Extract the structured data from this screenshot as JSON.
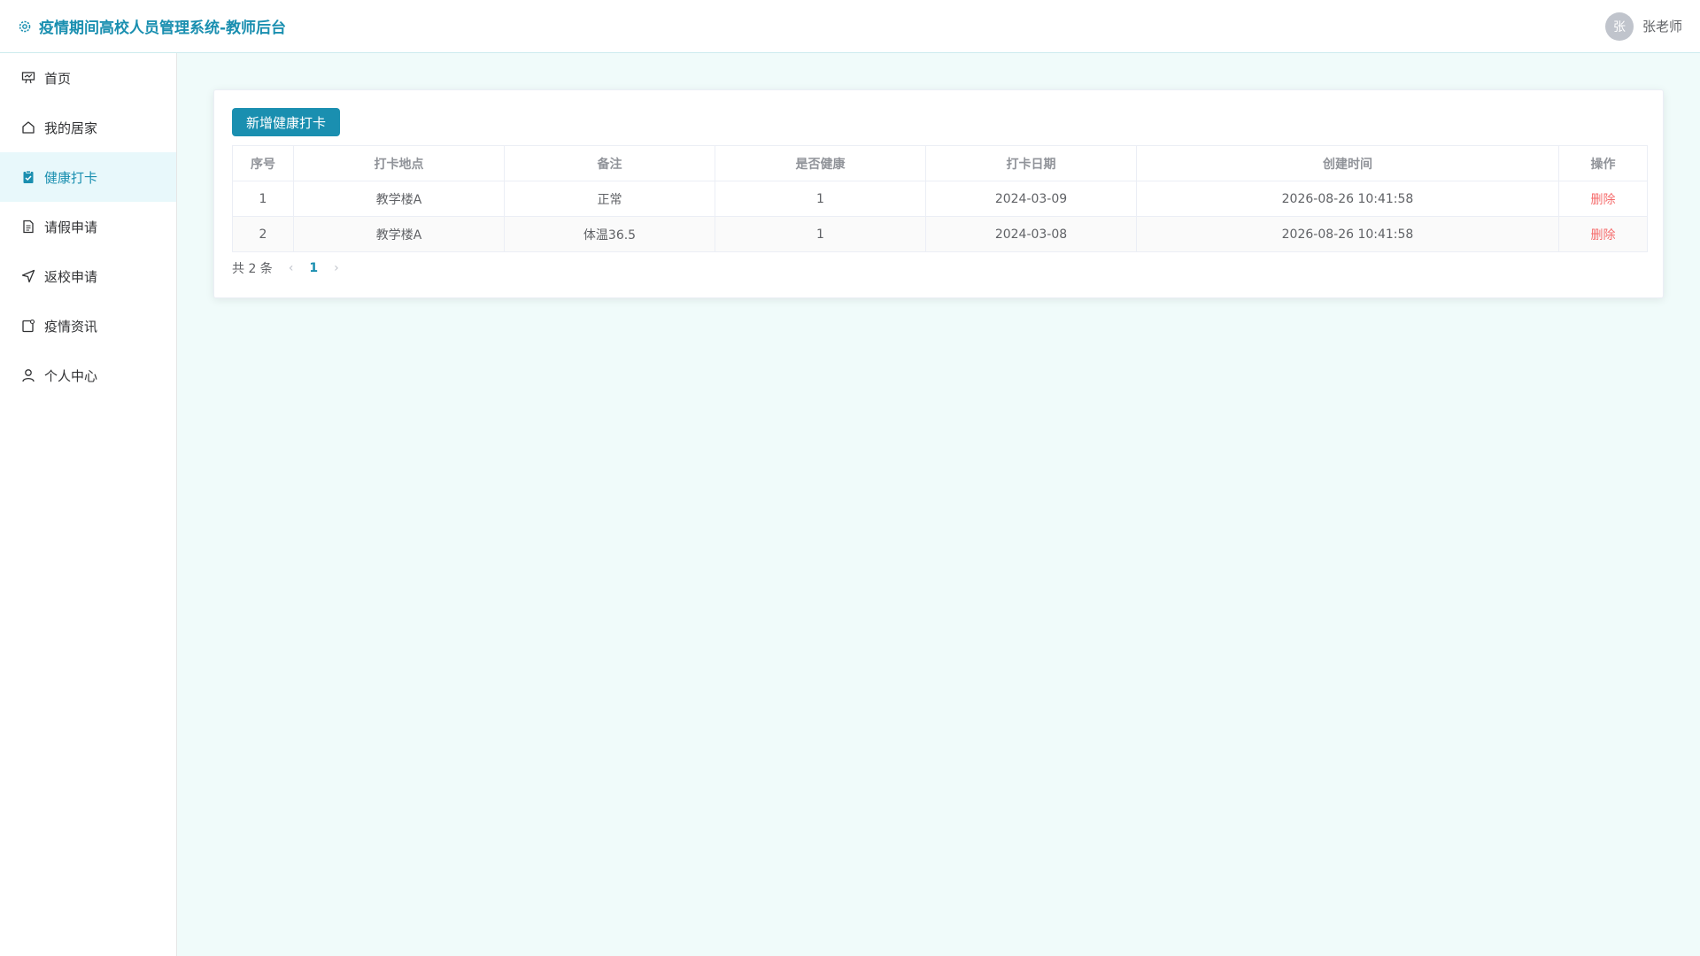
{
  "header": {
    "title": "疫情期间高校人员管理系统-教师后台",
    "user_avatar_text": "张",
    "user_name": "张老师"
  },
  "sidebar": {
    "items": [
      {
        "label": "首页",
        "icon": "presentation-icon"
      },
      {
        "label": "我的居家",
        "icon": "home-icon"
      },
      {
        "label": "健康打卡",
        "icon": "clipboard-check-icon",
        "active": true
      },
      {
        "label": "请假申请",
        "icon": "document-icon"
      },
      {
        "label": "返校申请",
        "icon": "send-icon"
      },
      {
        "label": "疫情资讯",
        "icon": "news-icon"
      },
      {
        "label": "个人中心",
        "icon": "user-icon"
      }
    ]
  },
  "main": {
    "add_button": "新增健康打卡",
    "table": {
      "headers": [
        "序号",
        "打卡地点",
        "备注",
        "是否健康",
        "打卡日期",
        "创建时间",
        "操作"
      ],
      "rows": [
        [
          "1",
          "教学楼A",
          "正常",
          "1",
          "2024-03-09",
          "2026-08-26 10:41:58",
          "删除"
        ],
        [
          "2",
          "教学楼A",
          "体温36.5",
          "1",
          "2024-03-08",
          "2026-08-26 10:41:58",
          "删除"
        ]
      ]
    },
    "pagination": {
      "total": "共 2 条",
      "prev": "‹",
      "current": "1",
      "next": "›"
    }
  },
  "colors": {
    "accent": "#1a8fb0",
    "delete": "#f56c6c",
    "background": "#f0fbfa"
  }
}
